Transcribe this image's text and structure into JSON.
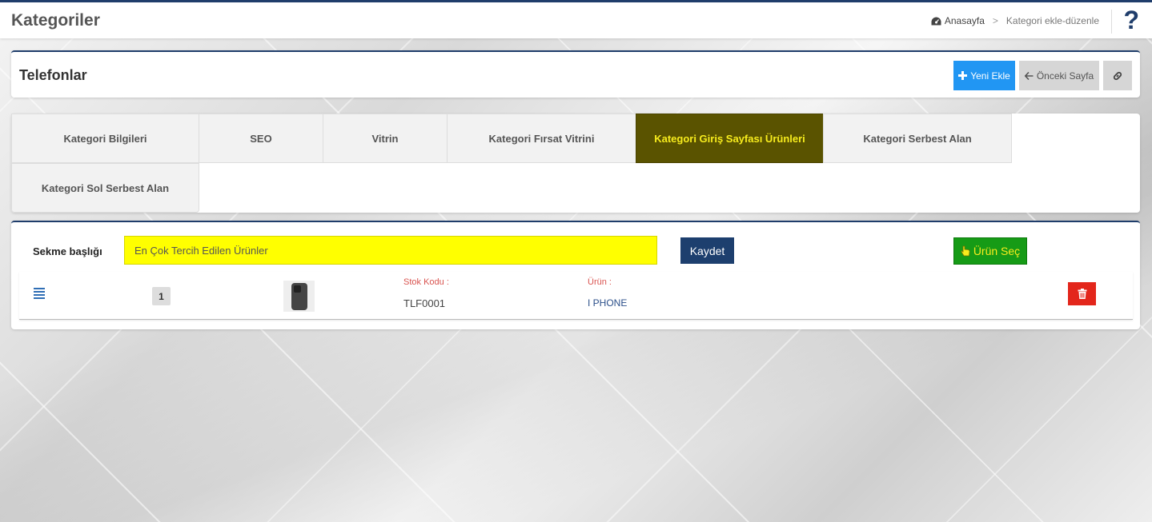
{
  "page": {
    "title": "Kategoriler"
  },
  "breadcrumb": {
    "home": "Anasayfa",
    "separator": ">",
    "current": "Kategori ekle-düzenle"
  },
  "help": {
    "label": "?"
  },
  "header": {
    "title": "Telefonlar",
    "new_label": "Yeni Ekle",
    "prev_label": "Önceki Sayfa"
  },
  "tabs": [
    {
      "label": "Kategori Bilgileri"
    },
    {
      "label": "SEO"
    },
    {
      "label": "Vitrin"
    },
    {
      "label": "Kategori Fırsat Vitrini"
    },
    {
      "label": "Kategori Giriş Sayfası Ürünleri",
      "active": true
    },
    {
      "label": "Kategori Serbest Alan"
    },
    {
      "label": "Kategori Sol Serbest Alan"
    }
  ],
  "form": {
    "tab_title_label": "Sekme başlığı",
    "tab_title_value": "En Çok Tercih Edilen Ürünler",
    "save_label": "Kaydet",
    "select_product_label": "Ürün Seç"
  },
  "products": [
    {
      "order": "1",
      "stock_code_label": "Stok Kodu :",
      "stock_code": "TLF0001",
      "product_label": "Ürün :",
      "product_name": "I PHONE"
    }
  ],
  "colors": {
    "brand": "#1f3d6b",
    "primary": "#2196f3",
    "active_tab_bg": "#5a5300",
    "active_tab_text": "#f7ec1d",
    "highlight": "#ffff00",
    "success": "#169b16",
    "danger": "#e3261b"
  }
}
